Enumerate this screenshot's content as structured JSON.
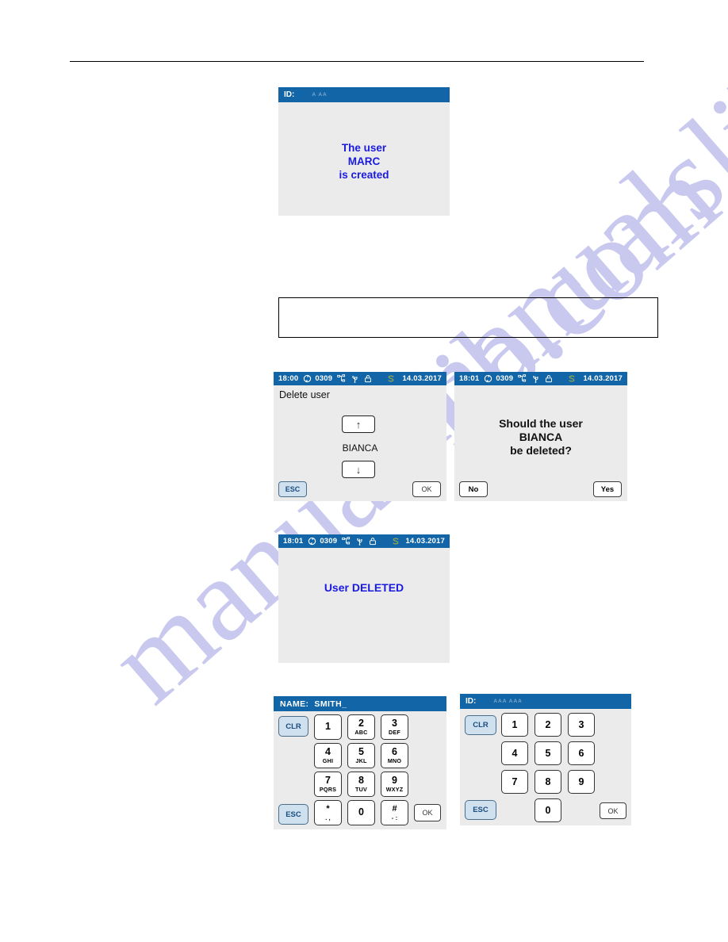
{
  "page": {
    "watermark_text": "manualslib.com",
    "note_box_text": ""
  },
  "screens": {
    "user_created": {
      "name": "user-created-screen",
      "titlebar": {
        "label": "ID:",
        "faint_value": "A AA"
      },
      "message_lines": [
        "The user",
        "MARC",
        "is created"
      ]
    },
    "delete_user": {
      "name": "delete-user-screen",
      "statusbar": {
        "time": "18:00",
        "counter": "0309",
        "date": "14.03.2017",
        "icons": [
          "sync-icon",
          "network-icon",
          "usb-icon",
          "lock-icon",
          "s-logo-icon"
        ]
      },
      "title": "Delete user",
      "selected_user": "BIANCA",
      "up_button": "↑",
      "down_button": "↓",
      "esc_button": "ESC",
      "ok_button": "OK"
    },
    "confirm_delete": {
      "name": "confirm-delete-screen",
      "statusbar": {
        "time": "18:01",
        "counter": "0309",
        "date": "14.03.2017",
        "icons": [
          "sync-icon",
          "network-icon",
          "usb-icon",
          "lock-icon",
          "s-logo-icon"
        ]
      },
      "message_lines": [
        "Should the user",
        "BIANCA",
        "be deleted?"
      ],
      "no_button": "No",
      "yes_button": "Yes"
    },
    "user_deleted": {
      "name": "user-deleted-screen",
      "statusbar": {
        "time": "18:01",
        "counter": "0309",
        "date": "14.03.2017",
        "icons": [
          "sync-icon",
          "network-icon",
          "usb-icon",
          "lock-icon",
          "s-logo-icon"
        ]
      },
      "message_lines": [
        "User DELETED"
      ]
    },
    "name_keypad": {
      "name": "name-entry-keypad-screen",
      "titlebar": {
        "label": "NAME:",
        "value": "SMITH_"
      },
      "clr_button": "CLR",
      "esc_button": "ESC",
      "ok_button": "OK",
      "keys": [
        {
          "digit": "1",
          "letters": ""
        },
        {
          "digit": "2",
          "letters": "ABC"
        },
        {
          "digit": "3",
          "letters": "DEF"
        },
        {
          "digit": "4",
          "letters": "GHI"
        },
        {
          "digit": "5",
          "letters": "JKL"
        },
        {
          "digit": "6",
          "letters": "MNO"
        },
        {
          "digit": "7",
          "letters": "PQRS"
        },
        {
          "digit": "8",
          "letters": "TUV"
        },
        {
          "digit": "9",
          "letters": "WXYZ"
        },
        {
          "digit": "*",
          "letters": ". ,"
        },
        {
          "digit": "0",
          "letters": ""
        },
        {
          "digit": "#",
          "letters": "- :"
        }
      ]
    },
    "id_keypad": {
      "name": "id-entry-keypad-screen",
      "titlebar": {
        "label": "ID:",
        "faint_value": "AAA AAA"
      },
      "clr_button": "CLR",
      "esc_button": "ESC",
      "ok_button": "OK",
      "keys": [
        "1",
        "2",
        "3",
        "4",
        "5",
        "6",
        "7",
        "8",
        "9",
        "0"
      ]
    }
  },
  "colors": {
    "titlebar_blue": "#1266a8",
    "screen_bg": "#ebebeb",
    "message_blue": "#1a1ae0",
    "esc_fill": "#cfe0ef",
    "watermark": "#c9c9ef"
  }
}
